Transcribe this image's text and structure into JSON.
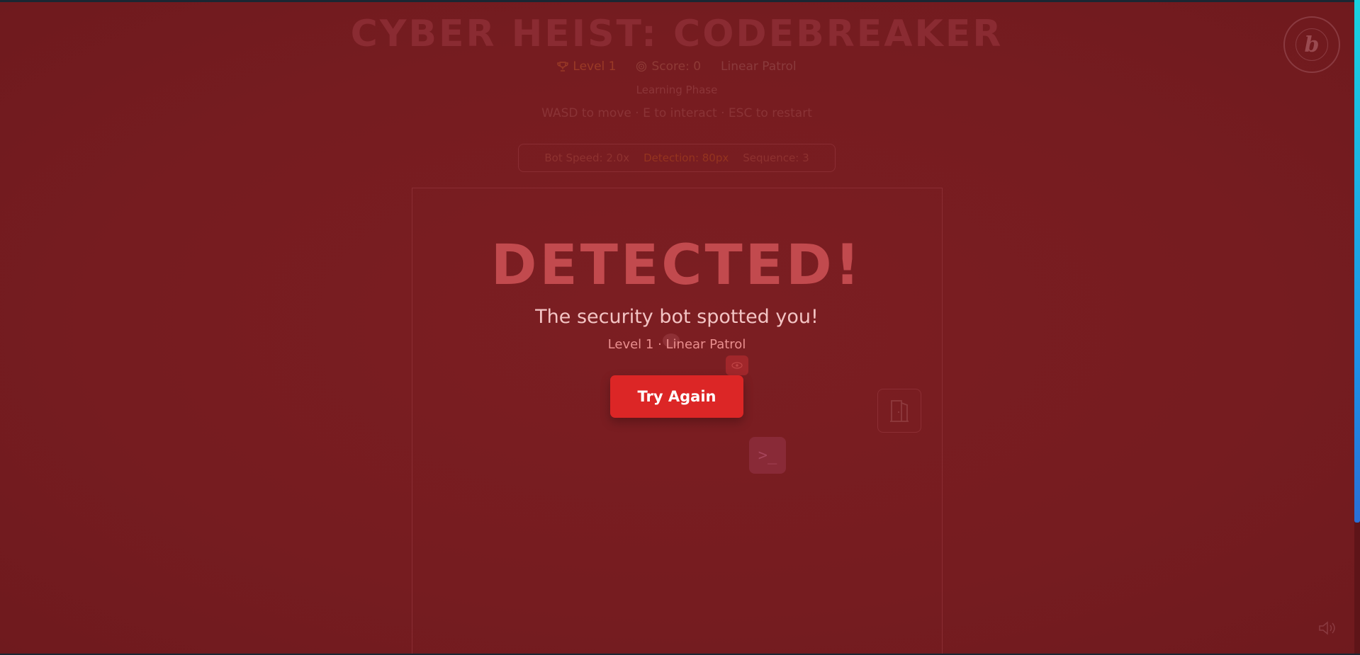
{
  "header": {
    "title": "CYBER HEIST: CODEBREAKER",
    "level": "Level 1",
    "score": "Score: 0",
    "mode": "Linear Patrol",
    "phase": "Learning Phase",
    "controls": "WASD to move · E to interact · ESC to restart"
  },
  "config": {
    "bot_speed": "Bot Speed: 2.0x",
    "detection": "Detection: 80px",
    "sequence": "Sequence: 3"
  },
  "overlay": {
    "headline": "DETECTED!",
    "message": "The security bot spotted you!",
    "level_info": "Level 1 · Linear Patrol",
    "retry_label": "Try Again"
  },
  "board": {
    "terminal_glyph": ">_",
    "exit_icon": "door-icon",
    "bot_icon": "eye-icon"
  },
  "icons": {
    "level": "trophy-icon",
    "score": "target-icon",
    "sound": "speaker-icon",
    "badge": "b-logo-icon"
  },
  "colors": {
    "background": "#7a1d21",
    "retry_button": "#dc2626",
    "headline": "#c24a4e",
    "scroll_thumb": "#19d3e0"
  }
}
